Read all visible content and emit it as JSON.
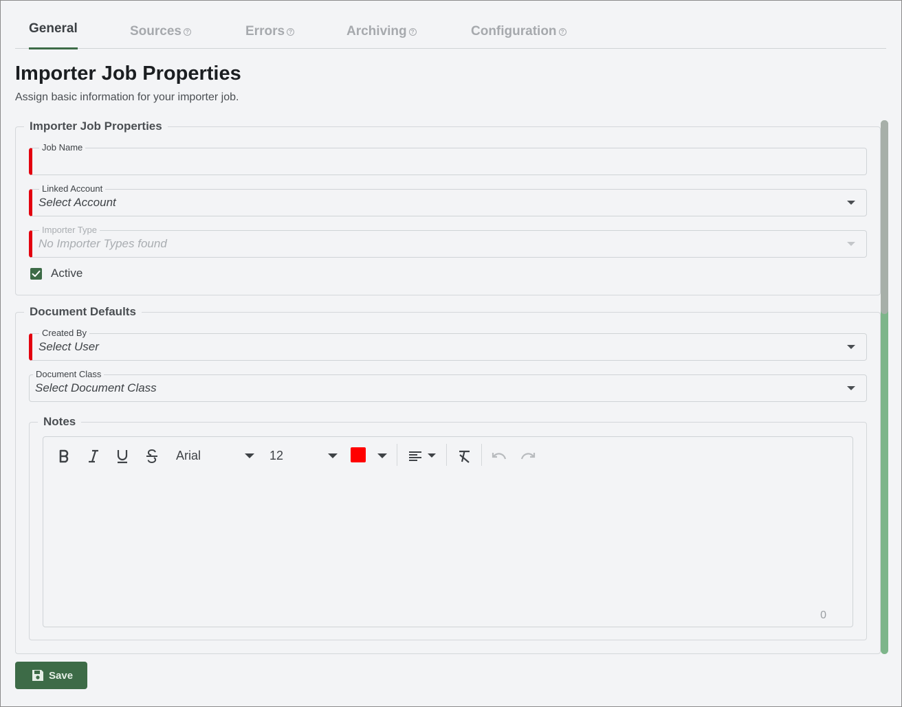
{
  "tabs": [
    {
      "label": "General",
      "active": true,
      "help": false
    },
    {
      "label": "Sources",
      "active": false,
      "help": true
    },
    {
      "label": "Errors",
      "active": false,
      "help": true
    },
    {
      "label": "Archiving",
      "active": false,
      "help": true
    },
    {
      "label": "Configuration",
      "active": false,
      "help": true
    }
  ],
  "header": {
    "title": "Importer Job Properties",
    "subtitle": "Assign basic information for your importer job."
  },
  "job_properties": {
    "legend": "Importer Job Properties",
    "job_name": {
      "label": "Job Name",
      "value": ""
    },
    "linked_account": {
      "label": "Linked Account",
      "value": "Select Account"
    },
    "importer_type": {
      "label": "Importer Type",
      "value": "No Importer Types found"
    },
    "active": {
      "label": "Active",
      "checked": true
    }
  },
  "document_defaults": {
    "legend": "Document Defaults",
    "created_by": {
      "label": "Created By",
      "value": "Select User"
    },
    "document_class": {
      "label": "Document Class",
      "value": "Select Document Class"
    }
  },
  "notes": {
    "legend": "Notes",
    "font_family": "Arial",
    "font_size": "12",
    "font_color": "#ff0000",
    "char_count": "0",
    "tools": [
      "bold-icon",
      "italic-icon",
      "underline-icon",
      "strikethrough-icon",
      "align-left-icon",
      "clear-format-icon",
      "undo-icon",
      "redo-icon"
    ]
  },
  "actions": {
    "save_label": "Save"
  },
  "colors": {
    "accent": "#3d6b47",
    "required": "#e3000f",
    "scroll_track": "#7db58a"
  }
}
